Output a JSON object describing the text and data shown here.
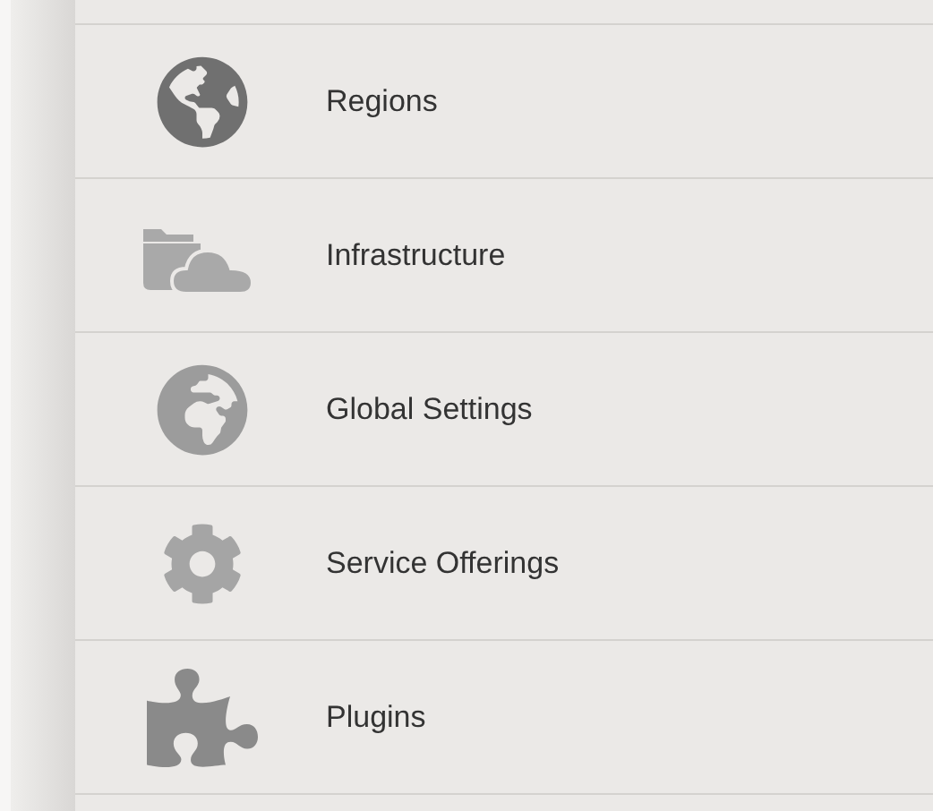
{
  "menu": {
    "items": [
      {
        "kind": "globe",
        "label": "Regions"
      },
      {
        "kind": "folder-cloud",
        "label": "Infrastructure"
      },
      {
        "kind": "world",
        "label": "Global Settings"
      },
      {
        "kind": "gear",
        "label": "Service Offerings"
      },
      {
        "kind": "puzzle",
        "label": "Plugins"
      }
    ]
  }
}
